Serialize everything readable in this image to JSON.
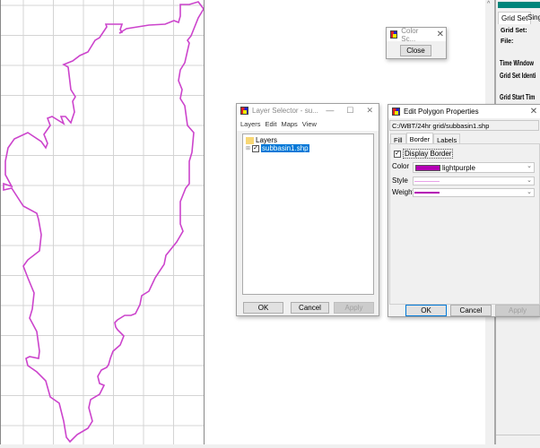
{
  "map": {
    "grid": true,
    "polygon_color": "#cc44cc"
  },
  "color_scale_window": {
    "title": "Color Sc...",
    "close_label": "Close"
  },
  "layer_selector": {
    "title": "Layer Selector - su...",
    "menu": [
      "Layers",
      "Edit",
      "Maps",
      "View"
    ],
    "tree_root": "Layers",
    "layer_name": "subbasin1.shp",
    "layer_checked": true,
    "buttons": {
      "ok": "OK",
      "cancel": "Cancel",
      "apply": "Apply"
    }
  },
  "edit_polygon": {
    "title": "Edit Polygon Properties",
    "path": "C:/WBT/24hr grid/subbasin1.shp",
    "tabs": [
      "Fill",
      "Border",
      "Labels"
    ],
    "active_tab": "Border",
    "display_border_label": "Display Border",
    "display_border_checked": true,
    "color_label": "Color",
    "color_value": "lightpurple",
    "color_swatch": "#b400b4",
    "style_label": "Style",
    "style_color": "#e8a0e8",
    "weight_label": "Weight",
    "weight_color": "#b400b4",
    "buttons": {
      "ok": "OK",
      "cancel": "Cancel",
      "apply": "Apply"
    }
  },
  "right_panel": {
    "accent": "#00857a",
    "tabs": [
      "Grid Set",
      "Sing"
    ],
    "fields": [
      "Grid Set:",
      "File:",
      "Time Window",
      "Grid Set Identi",
      "Grid Start Tim"
    ]
  }
}
